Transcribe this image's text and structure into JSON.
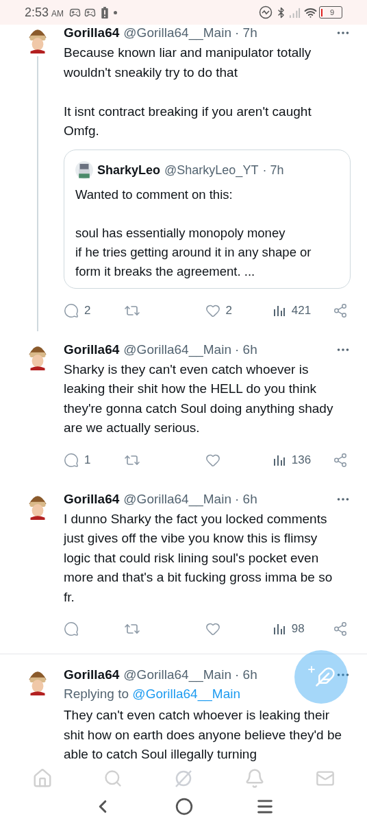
{
  "status_bar": {
    "time": "2:53",
    "meridiem": "AM",
    "battery": "9"
  },
  "tweets": [
    {
      "name": "Gorilla64",
      "handle": "@Gorilla64__Main",
      "time": "· 7h",
      "thread_line": true,
      "text": "Because known liar and manipulator totally wouldn't sneakily try to do that\n\nIt isnt contract breaking if you aren't caught\nOmfg.",
      "quote": {
        "name": "SharkyLeo",
        "handle": "@SharkyLeo_YT",
        "time": "· 7h",
        "text": "Wanted to comment on this:\n\nsoul has essentially monopoly money\nif he tries getting around it in any shape or form it breaks the agreement. ..."
      },
      "stats": {
        "replies": "2",
        "likes": "2",
        "views": "421"
      }
    },
    {
      "name": "Gorilla64",
      "handle": "@Gorilla64__Main",
      "time": "· 6h",
      "thread_line": false,
      "text": "Sharky is they can't even catch whoever is leaking their shit how the HELL do you think they're gonna catch Soul doing anything shady are we actually serious.",
      "stats": {
        "replies": "1",
        "views": "136"
      }
    },
    {
      "name": "Gorilla64",
      "handle": "@Gorilla64__Main",
      "time": "· 6h",
      "thread_line": false,
      "text": "I dunno Sharky the fact you locked comments just gives off the vibe you know this is flimsy logic that could risk lining soul's pocket even more and that's a bit fucking gross imma be so fr.",
      "stats": {
        "views": "98"
      }
    },
    {
      "name": "Gorilla64",
      "handle": "@Gorilla64__Main",
      "time": "· 6h",
      "thread_line": false,
      "divider_above": true,
      "replying_label": "Replying to",
      "replying_to": "@Gorilla64__Main",
      "text": "They can't even catch whoever is leaking their shit how on earth does anyone believe they'd be able to catch Soul illegally turning"
    }
  ]
}
